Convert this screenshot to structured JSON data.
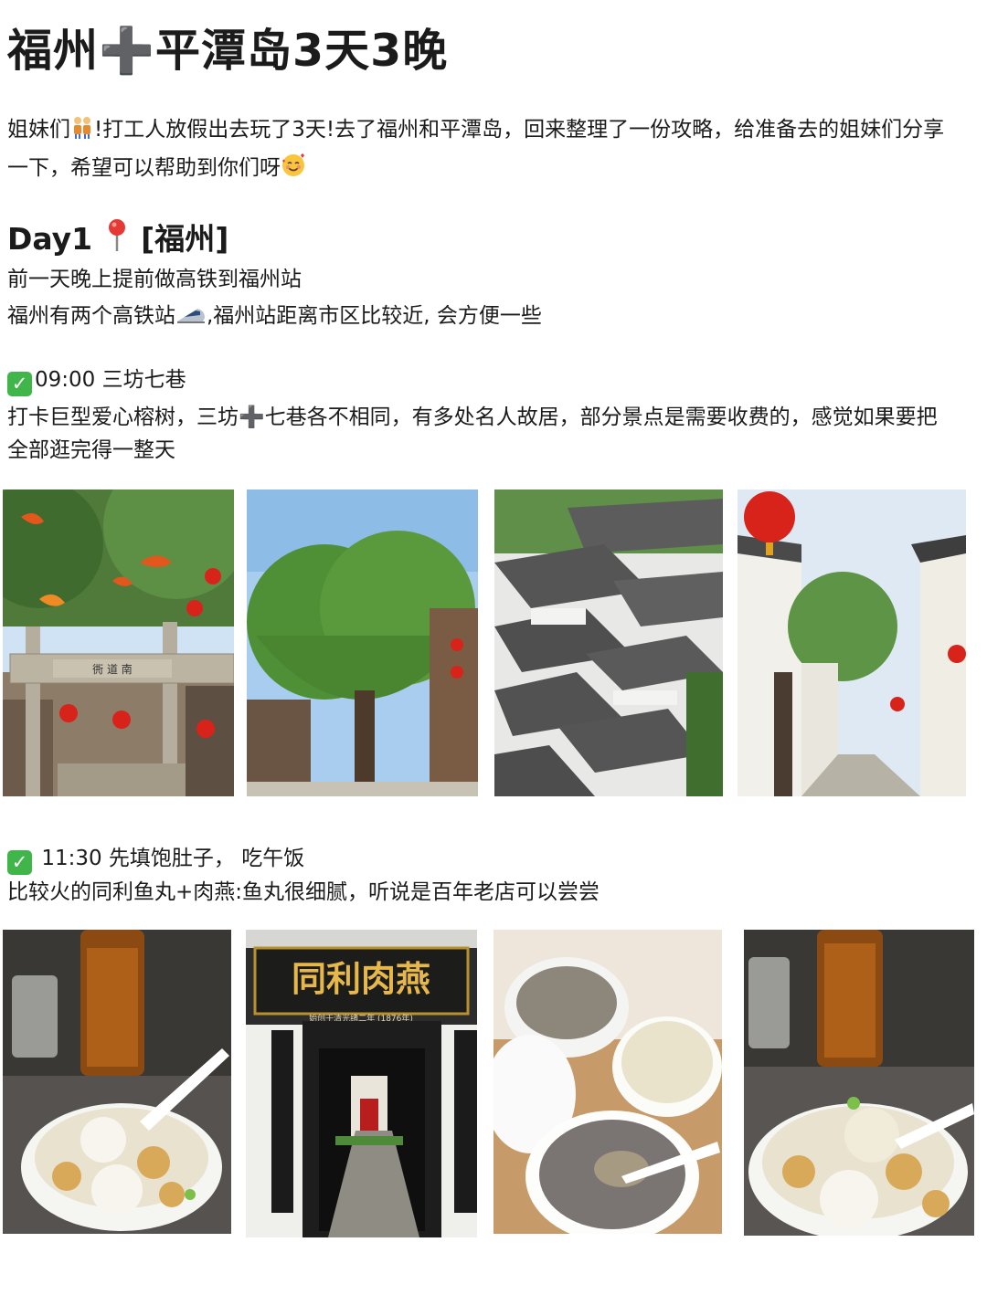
{
  "title": "福州➕平潭岛3天3晚",
  "intro": {
    "line1_a": "姐妹们",
    "line1_b": "!打工人放假出去玩了3天!去了福州和平潭岛，回来整理了一份攻略，给准备去的姐妹们分享",
    "line2": "一下，希望可以帮助到你们呀",
    "icons": [
      "sisters-emoji",
      "smiling-face-with-hearts-emoji"
    ]
  },
  "day1": {
    "label": "Day1",
    "pin_icon": "round-pushpin-emoji",
    "place": "[福州]",
    "line1": "前一天晚上提前做高铁到福州站",
    "line2_a": "福州有两个高铁站",
    "line2_b": ",福州站距离市区比较近, 会方便一些",
    "train_icon": "high-speed-train-emoji"
  },
  "section1": {
    "check_icon": "check-mark-button",
    "heading": "09:00 三坊七巷",
    "desc1": "打卡巨型爱心榕树，三坊➕七巷各不相同，有多处名人故居，部分景点是需要收费的，感觉如果要把",
    "desc2": "全部逛完得一整天",
    "photos": [
      "archway-photo",
      "heart-banyan-tree-photo",
      "rooftops-aerial-photo",
      "white-wall-alley-photo"
    ],
    "archway_text": "衖 道 南"
  },
  "section2": {
    "check_icon": "check-mark-button",
    "heading": "11:30 先填饱肚子， 吃午饭",
    "desc": "比较火的同利鱼丸+肉燕:鱼丸很细腻，听说是百年老店可以尝尝",
    "photos": [
      "fishball-soup-photo",
      "tongli-shopfront-photo",
      "desserts-bowls-photo",
      "fishball-soup-closeup-photo"
    ],
    "shop_sign": "同利肉燕",
    "shop_subsign": "始创于清光绪二年 (1876年)",
    "couplet_left": "巧手飞槌打就传统闽都美馔",
    "couplet_right": "丹心献艺捧出民间太平佳肴"
  },
  "colors": {
    "check_green": "#40b64a",
    "lantern_red": "#d8231b",
    "text": "#1b1b1b"
  }
}
